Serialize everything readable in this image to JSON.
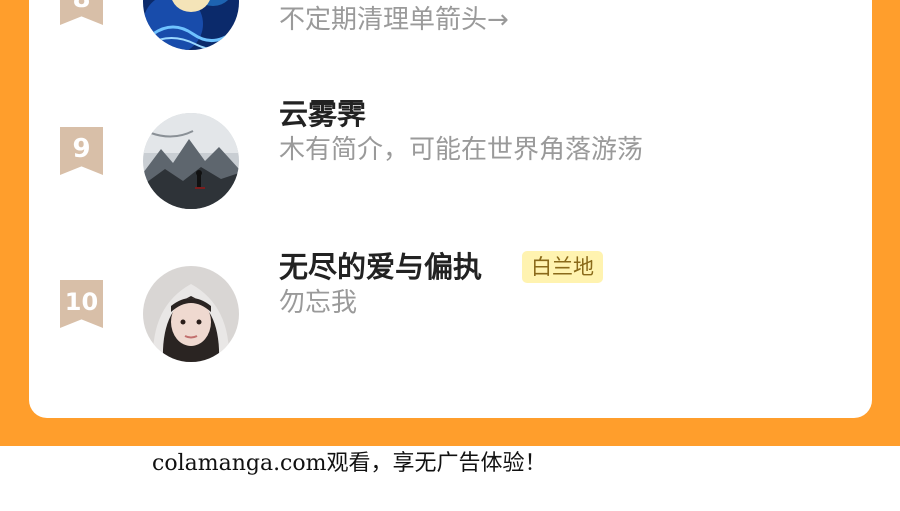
{
  "ranking": {
    "rows": [
      {
        "rank": "8",
        "name": "",
        "tag": "",
        "bio": "不定期清理单箭头→",
        "avatar_icon": "avatar-blue-character-icon"
      },
      {
        "rank": "9",
        "name": "云雾霁",
        "tag": "",
        "bio": "木有简介，可能在世界角落游荡",
        "avatar_icon": "avatar-misty-landscape-icon"
      },
      {
        "rank": "10",
        "name": "无尽的爱与偏执",
        "tag": "白兰地",
        "bio": "勿忘我",
        "avatar_icon": "avatar-girl-portrait-icon"
      }
    ]
  },
  "footer": {
    "text": "colamanga.com观看，享无广告体验！"
  },
  "colors": {
    "accent_orange": "#FF9E2C",
    "rank_badge": "#D8BFA8",
    "tag_background": "#FFF3B0",
    "tag_text": "#8A6A1A",
    "bio_text": "#9A9A9A"
  }
}
